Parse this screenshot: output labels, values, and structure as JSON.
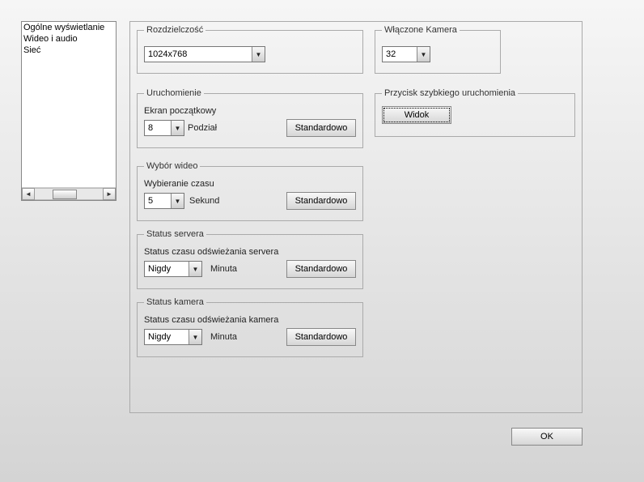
{
  "sidebar": {
    "items": [
      {
        "label": "Ogólne wyświetlanie"
      },
      {
        "label": "Wideo i audio"
      },
      {
        "label": "Sieć"
      }
    ]
  },
  "groups": {
    "resolution": {
      "legend": "Rozdzielczość",
      "value": "1024x768"
    },
    "camera_on": {
      "legend": "Włączone Kamera",
      "value": "32"
    },
    "startup": {
      "legend": "Uruchomienie",
      "field_label": "Ekran początkowy",
      "value": "8",
      "unit": "Podział",
      "button": "Standardowo"
    },
    "quick_launch": {
      "legend": "Przycisk szybkiego uruchomienia",
      "button": "Widok"
    },
    "video_select": {
      "legend": "Wybór wideo",
      "field_label": "Wybieranie czasu",
      "value": "5",
      "unit": "Sekund",
      "button": "Standardowo"
    },
    "server_status": {
      "legend": "Status servera",
      "field_label": "Status czasu odświeżania servera",
      "value": "Nigdy",
      "unit": "Minuta",
      "button": "Standardowo"
    },
    "camera_status": {
      "legend": "Status kamera",
      "field_label": "Status czasu odświeżania kamera",
      "value": "Nigdy",
      "unit": "Minuta",
      "button": "Standardowo"
    }
  },
  "footer": {
    "ok": "OK"
  }
}
